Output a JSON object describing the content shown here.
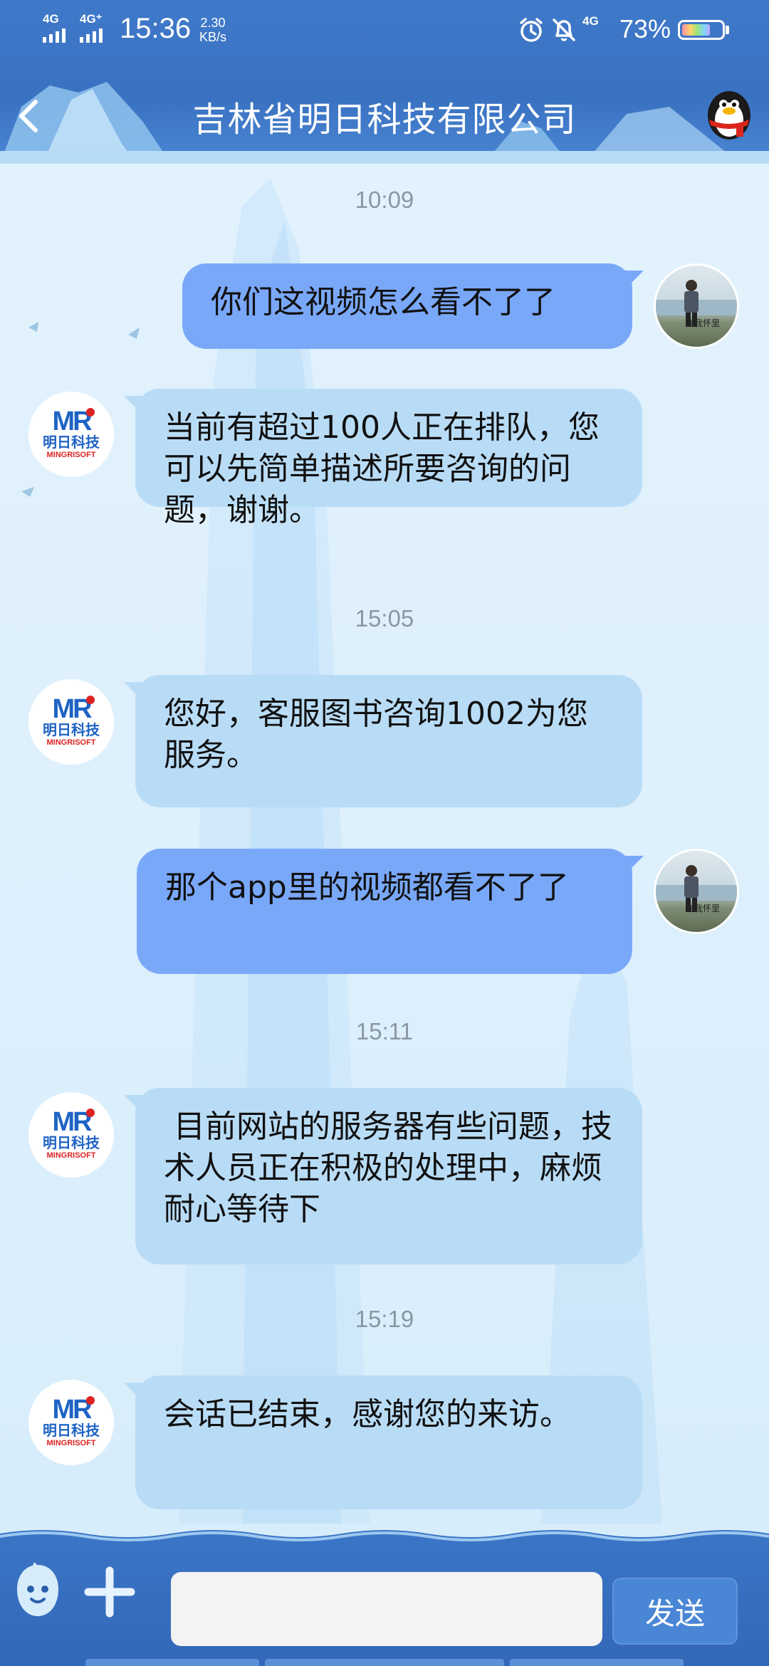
{
  "status_bar": {
    "sim1": "4G",
    "sim2": "4G⁺",
    "time": "15:36",
    "speed_value": "2.30",
    "speed_unit": "KB/s",
    "network": "4G",
    "battery_percent": "73%",
    "battery_level": 0.73,
    "icons": [
      "alarm-icon",
      "mute-bell-icon",
      "battery-icon"
    ]
  },
  "header": {
    "title": "吉林省明日科技有限公司",
    "back_icon": "chevron-left-icon",
    "mascot_icon": "qq-penguin-icon"
  },
  "logo": {
    "mark": "MR",
    "cn": "明日科技",
    "en": "MINGRISOFT"
  },
  "user_avatar": {
    "caption": "在我怀里"
  },
  "messages": [
    {
      "timestamp": "10:09"
    },
    {
      "side": "out",
      "text": "你们这视频怎么看不了了"
    },
    {
      "side": "in",
      "text": "当前有超过100人正在排队，您可以先简单描述所要咨询的问题，谢谢。"
    },
    {
      "timestamp": "15:05"
    },
    {
      "side": "in",
      "text": "您好，客服图书咨询1002为您服务。"
    },
    {
      "side": "out",
      "text": "那个app里的视频都看不了了"
    },
    {
      "timestamp": "15:11"
    },
    {
      "side": "in",
      "text": " 目前网站的服务器有些问题，技术人员正在积极的处理中，麻烦耐心等待下"
    },
    {
      "timestamp": "15:19"
    },
    {
      "side": "in",
      "text": "会话已结束，感谢您的来访。"
    }
  ],
  "input_bar": {
    "emoji_icon": "emoji-face-icon",
    "plus_icon": "plus-icon",
    "input_value": "",
    "send_label": "发送"
  },
  "colors": {
    "header_blue": "#3f79c9",
    "incoming_bubble": "#b9dcf6",
    "outgoing_bubble": "#7aa8f9",
    "send_button": "#4a86d6"
  }
}
